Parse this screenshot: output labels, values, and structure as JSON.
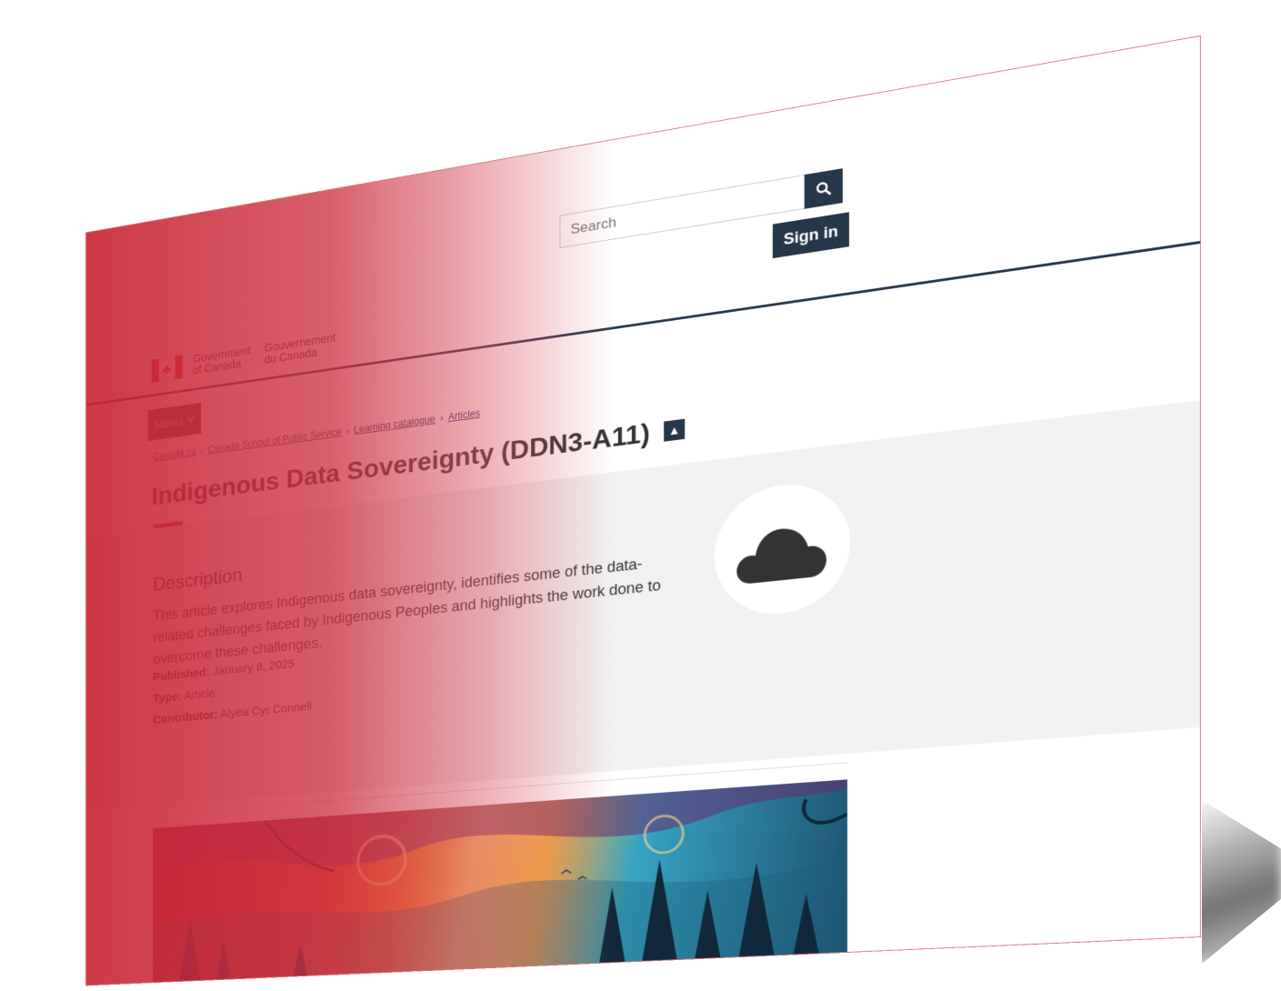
{
  "header": {
    "gov_en_line1": "Government",
    "gov_en_line2": "of Canada",
    "gov_fr_line1": "Gouvernement",
    "gov_fr_line2": "du Canada",
    "search_placeholder": "Search",
    "signin_label": "Sign in",
    "menu_label": "MENU"
  },
  "breadcrumb": [
    {
      "label": "Canada.ca"
    },
    {
      "label": "Canada School of Public Service"
    },
    {
      "label": "Learning catalogue"
    },
    {
      "label": "Articles"
    }
  ],
  "page": {
    "title": "Indigenous Data Sovereignty (DDN3-A11)",
    "description_heading": "Description",
    "description": "This article explores Indigenous data sovereignty, identifies some of the data-related challenges faced by Indigenous Peoples and highlights the work done to overcome these challenges.",
    "published_label": "Published:",
    "published_value": "January 8, 2025",
    "type_label": "Type:",
    "type_value": "Article",
    "contributor_label": "Contributor:",
    "contributor_value": "Alyea Cyr Connell"
  },
  "icons": {
    "search": "search-icon",
    "menu_chevron": "chevron-down-icon",
    "cloud": "cloud-icon",
    "badge": "csps-badge-icon"
  },
  "colors": {
    "primary_dark": "#26374a",
    "accent_red": "#af3c43",
    "flag_red": "#d52b1e",
    "overlay_red": "#c82837"
  }
}
